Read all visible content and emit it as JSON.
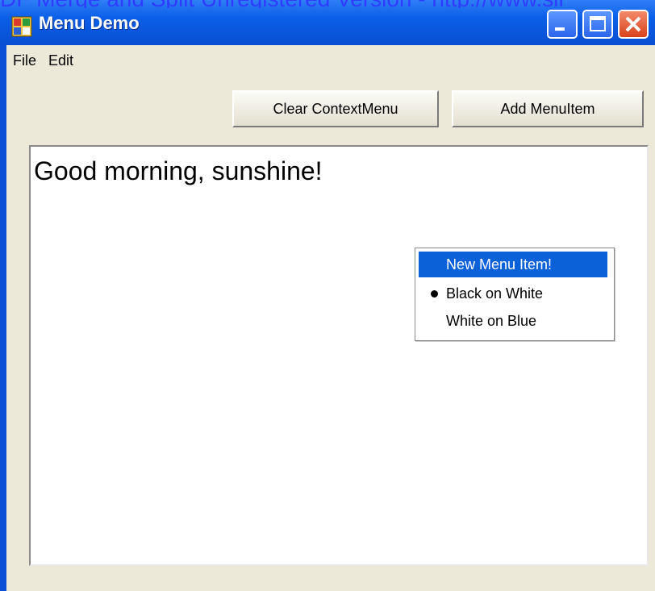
{
  "watermark": "DF Merge and Split Unregistered Version - http://www.sil",
  "window": {
    "title": "Menu Demo",
    "controls": [
      "minimize",
      "maximize",
      "close"
    ]
  },
  "menubar": {
    "items": [
      "File",
      "Edit"
    ]
  },
  "buttons": {
    "clear": "Clear ContextMenu",
    "add": "Add MenuItem"
  },
  "textbox": {
    "text": "Good morning, sunshine!"
  },
  "context_menu": {
    "items": [
      {
        "label": "New Menu Item!",
        "state": "highlighted"
      },
      {
        "label": "Black on White",
        "state": "checked-radio"
      },
      {
        "label": "White on Blue",
        "state": "normal"
      }
    ]
  },
  "colors": {
    "titlebar": "#0b5fe8",
    "highlight": "#0a61d8",
    "window_bg": "#ece9d8",
    "watermark": "#2f3cff"
  }
}
